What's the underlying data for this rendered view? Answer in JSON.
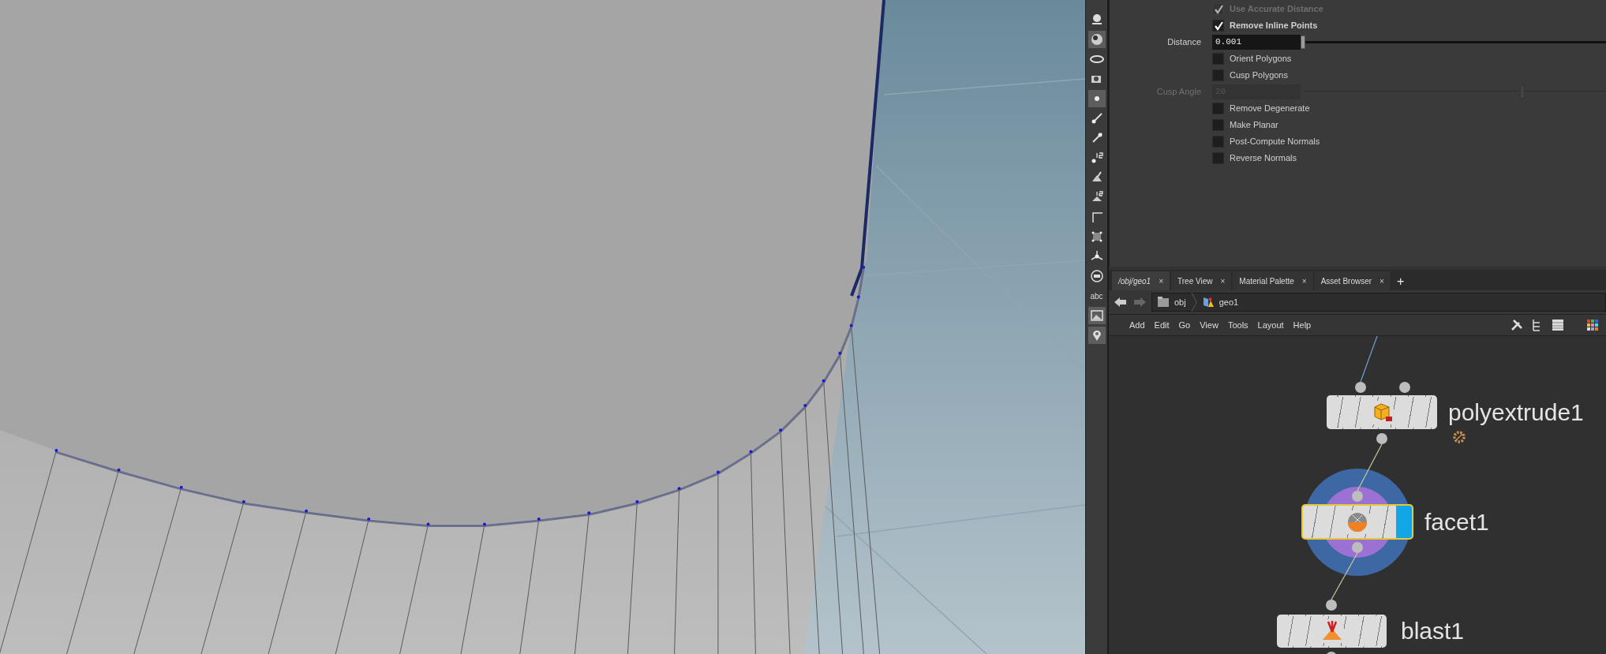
{
  "tools": [
    {
      "kind": "icon",
      "selected": false
    },
    {
      "kind": "icon",
      "selected": true
    },
    {
      "kind": "icon",
      "selected": false
    },
    {
      "kind": "icon",
      "selected": false
    },
    {
      "kind": "icon",
      "selected": true
    },
    {
      "kind": "icon",
      "selected": false
    },
    {
      "kind": "icon",
      "selected": false
    },
    {
      "kind": "icon",
      "selected": false
    },
    {
      "kind": "icon",
      "selected": false
    },
    {
      "kind": "icon",
      "selected": false
    },
    {
      "kind": "icon",
      "selected": false
    },
    {
      "kind": "icon",
      "selected": false
    },
    {
      "kind": "icon",
      "selected": false
    },
    {
      "kind": "icon",
      "selected": false
    },
    {
      "kind": "text",
      "label": "abc",
      "selected": false
    },
    {
      "kind": "icon",
      "selected": true
    },
    {
      "kind": "icon",
      "selected": true
    }
  ],
  "parameters": [
    {
      "kind": "toggle",
      "label": "Use Accurate Distance",
      "checked": true,
      "disabled": true
    },
    {
      "kind": "toggle",
      "label": "Remove Inline Points",
      "checked": true,
      "disabled": false
    },
    {
      "kind": "slider",
      "label": "Distance",
      "value": "0.001",
      "level": 0,
      "disabled": false
    },
    {
      "kind": "toggle",
      "label": "Orient Polygons",
      "checked": false,
      "disabled": false
    },
    {
      "kind": "toggle",
      "label": "Cusp Polygons",
      "checked": false,
      "disabled": false
    },
    {
      "kind": "slider",
      "label": "Cusp Angle",
      "value": "20",
      "level": 0.73,
      "disabled": true
    },
    {
      "kind": "toggle",
      "label": "Remove Degenerate",
      "checked": false,
      "disabled": false
    },
    {
      "kind": "toggle",
      "label": "Make Planar",
      "checked": false,
      "disabled": false
    },
    {
      "kind": "toggle",
      "label": "Post-Compute Normals",
      "checked": false,
      "disabled": false
    },
    {
      "kind": "toggle",
      "label": "Reverse Normals",
      "checked": false,
      "disabled": false
    }
  ],
  "pane_tabs": [
    {
      "label": "/obj/geo1",
      "close": "×",
      "selected": true
    },
    {
      "label": "Tree View",
      "close": "×",
      "selected": false
    },
    {
      "label": "Material Palette",
      "close": "×",
      "selected": false
    },
    {
      "label": "Asset Browser",
      "close": "×",
      "selected": false
    }
  ],
  "add_tab": "+",
  "path": [
    "obj",
    "geo1"
  ],
  "menu": [
    "Add",
    "Edit",
    "Go",
    "View",
    "Tools",
    "Layout",
    "Help"
  ],
  "nodes": [
    {
      "name": "polyextrude1",
      "selected": false,
      "display_flag": false,
      "highlighted": false,
      "badge": true
    },
    {
      "name": "facet1",
      "selected": true,
      "display_flag": true,
      "highlighted": true,
      "badge": false
    },
    {
      "name": "blast1",
      "selected": false,
      "display_flag": false,
      "highlighted": false,
      "badge": false
    }
  ]
}
